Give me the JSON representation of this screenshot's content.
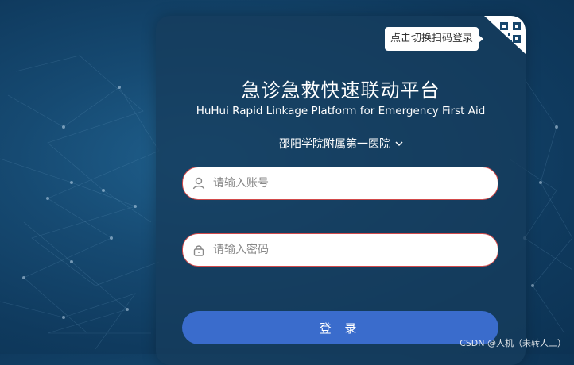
{
  "qr_login_hint": "点击切换扫码登录",
  "title": "急诊急救快速联动平台",
  "subtitle": "HuHui Rapid Linkage Platform for Emergency First Aid",
  "hospital_select": "邵阳学院附属第一医院",
  "username": {
    "placeholder": "请输入账号",
    "value": ""
  },
  "password": {
    "placeholder": "请输入密码",
    "value": ""
  },
  "login_button": "登 录",
  "watermark": "CSDN @人机（未转人工）",
  "colors": {
    "background": "#164a72",
    "button": "#3a6ccc",
    "input_border": "#d24a4a"
  },
  "icons": [
    "qr-code-icon",
    "user-icon",
    "lock-icon",
    "chevron-down-icon"
  ]
}
